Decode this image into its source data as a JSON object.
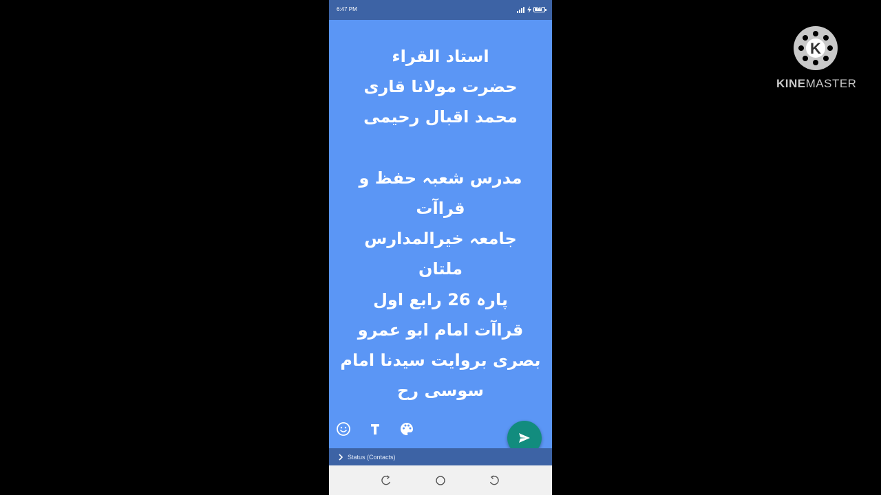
{
  "status_bar": {
    "time": "6:47 PM",
    "battery": "77",
    "battery_level": 0.77
  },
  "status_text": {
    "lines": [
      "استاد القراء",
      "حضرت مولانا قاری",
      "محمد اقبال رحیمی",
      "",
      "مدرس شعبہ حفظ و",
      "قراآت",
      "جامعہ خیرالمدارس",
      "ملتان",
      "پارہ 26 رابع اول",
      "قراآت امام ابو عمرو",
      "بصری بروایت سیدنا امام",
      "سوسی رح"
    ]
  },
  "toolbar": {
    "icons": [
      "emoji-icon",
      "text-style-icon",
      "palette-icon"
    ]
  },
  "send_button": {
    "icon": "send-icon",
    "color": "#128c7e"
  },
  "audience": {
    "label": "Status (Contacts)"
  },
  "nav": {
    "icons": [
      "back-icon",
      "home-icon",
      "recents-icon"
    ]
  },
  "watermark": {
    "brand_a": "KINE",
    "brand_b": "MASTER",
    "logo_letter": "K"
  },
  "colors": {
    "background": "#5b96f5",
    "status_bar": "#3d63a5",
    "send": "#128c7e"
  }
}
